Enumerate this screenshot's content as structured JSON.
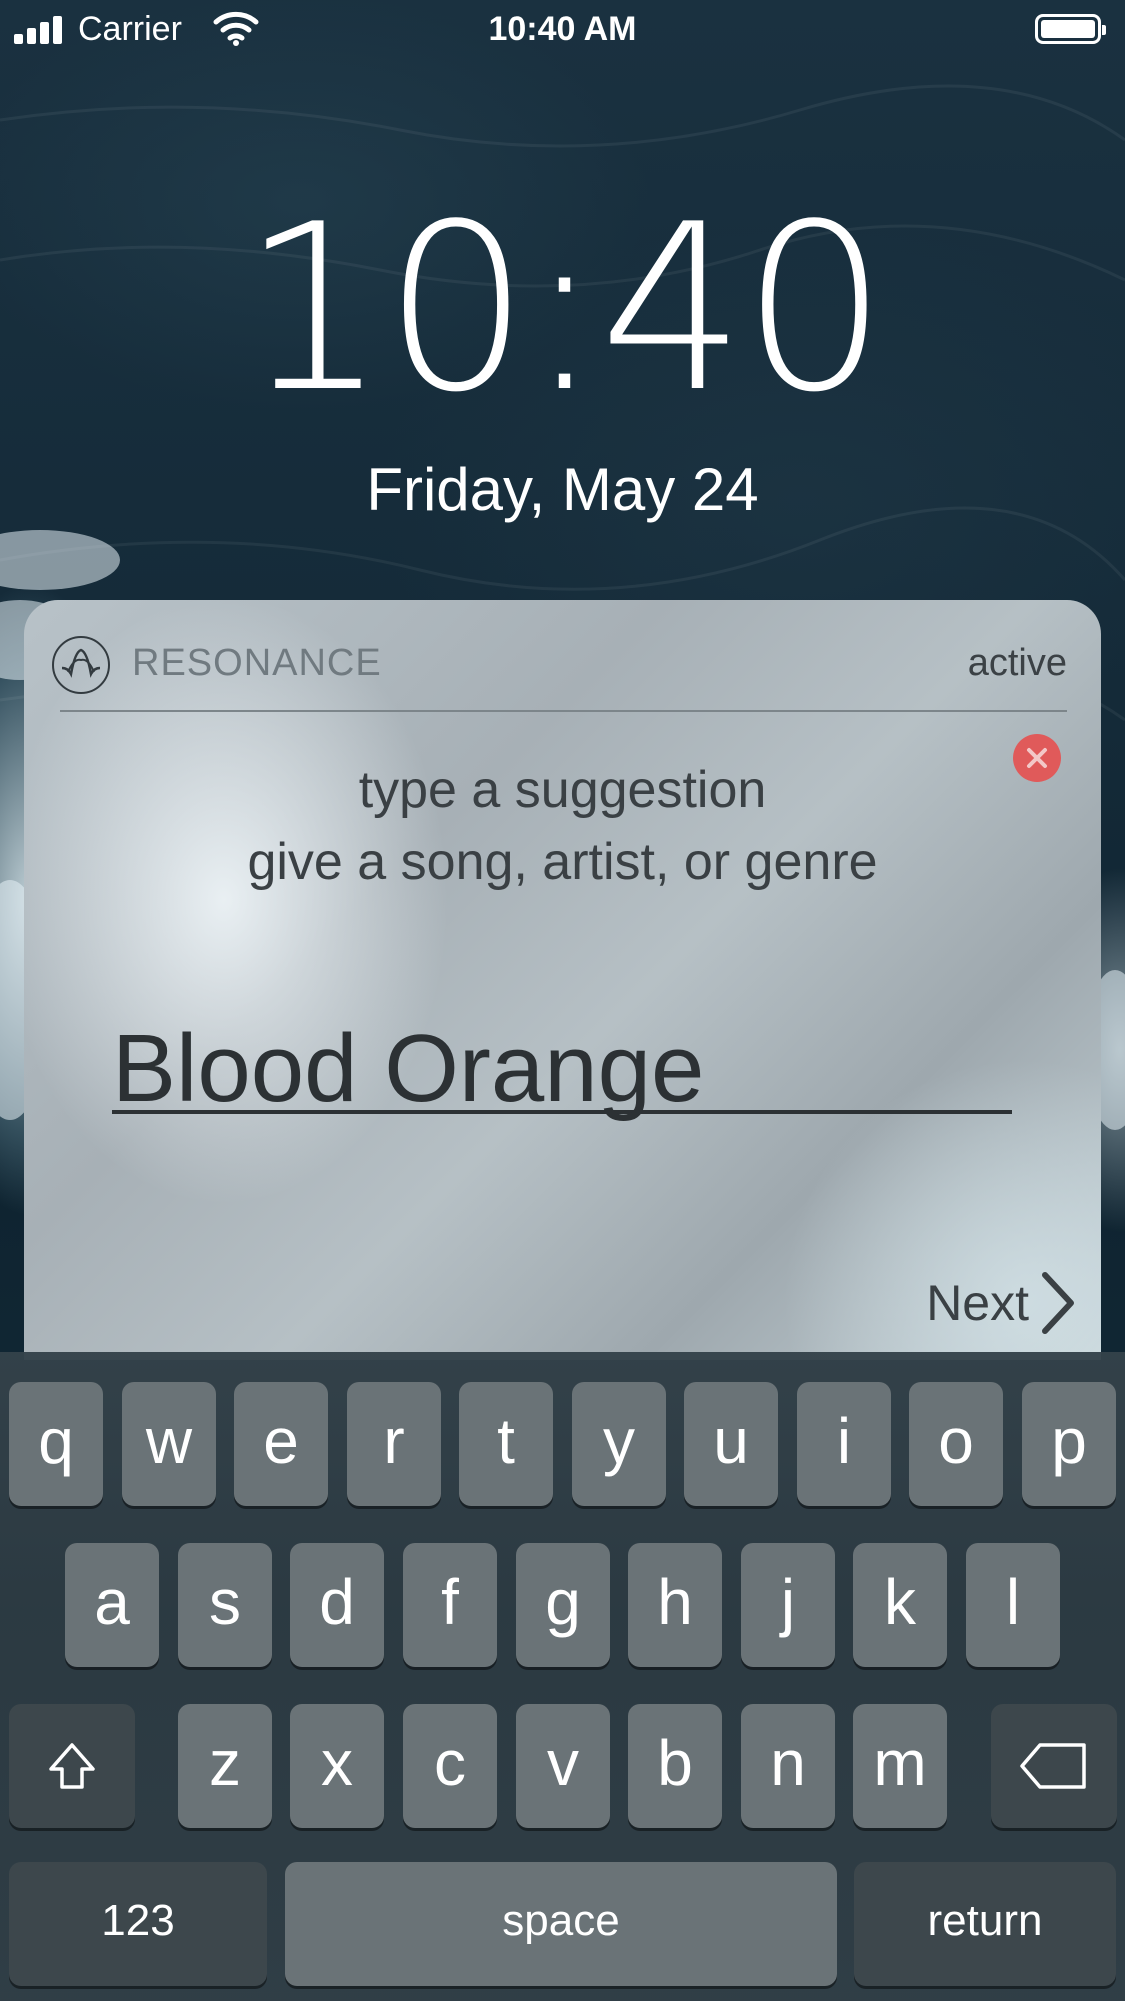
{
  "status_bar": {
    "carrier": "Carrier",
    "time": "10:40 AM",
    "icons": [
      "signal-icon",
      "wifi-icon",
      "battery-icon"
    ]
  },
  "lock_screen": {
    "time": "10:40",
    "date": "Friday, May 24"
  },
  "notification": {
    "app_name": "RESONANCE",
    "status": "active",
    "prompt_line1": "type a suggestion",
    "prompt_line2": "give a song, artist, or genre",
    "input_value": "Blood Orange",
    "next_label": "Next",
    "close_icon": "close-icon",
    "accent_close": "#e05a5a"
  },
  "keyboard": {
    "row1": [
      "q",
      "w",
      "e",
      "r",
      "t",
      "y",
      "u",
      "i",
      "o",
      "p"
    ],
    "row2": [
      "a",
      "s",
      "d",
      "f",
      "g",
      "h",
      "j",
      "k",
      "l"
    ],
    "row3": [
      "z",
      "x",
      "c",
      "v",
      "b",
      "n",
      "m"
    ],
    "numbers_label": "123",
    "space_label": "space",
    "return_label": "return"
  }
}
